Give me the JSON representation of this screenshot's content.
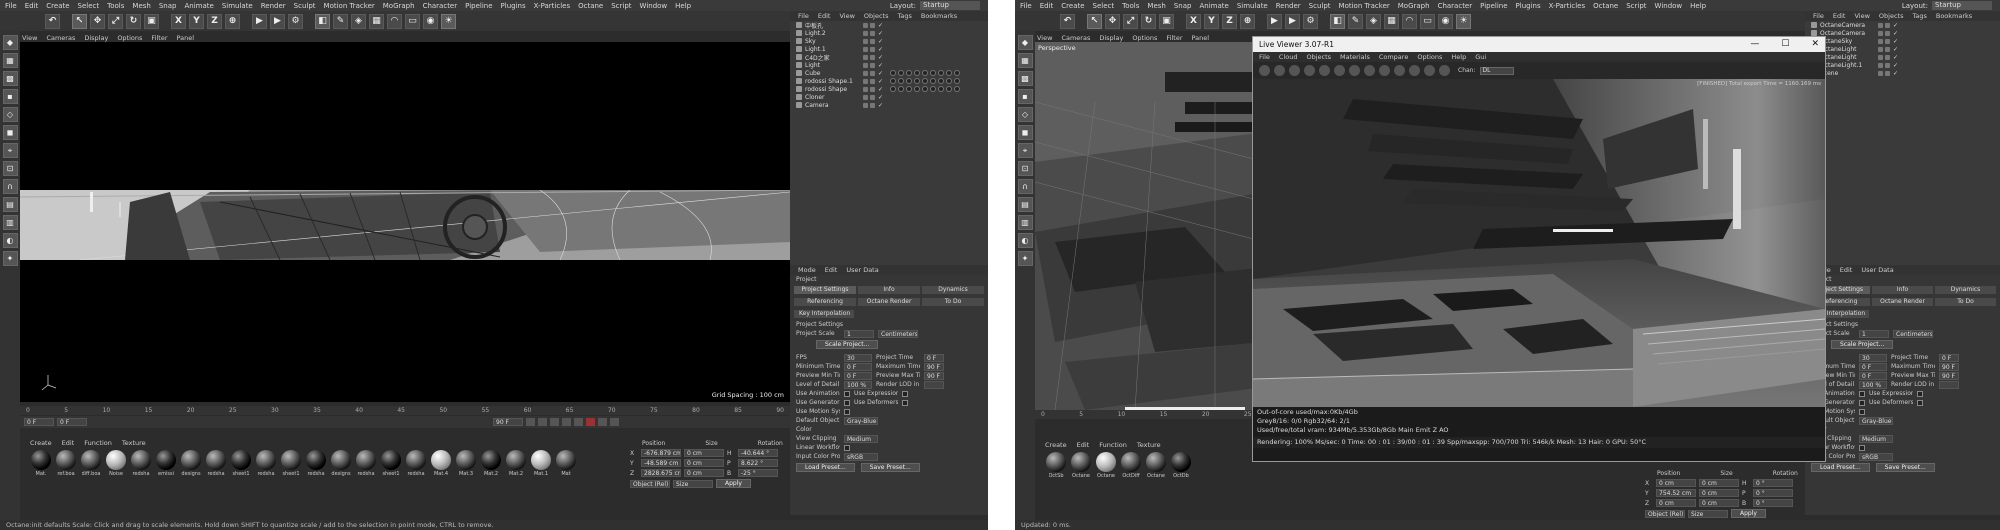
{
  "menu": [
    "File",
    "Edit",
    "Create",
    "Select",
    "Tools",
    "Mesh",
    "Snap",
    "Animate",
    "Simulate",
    "Render",
    "Sculpt",
    "Motion Tracker",
    "MoGraph",
    "Character",
    "Pipeline",
    "Plugins",
    "X-Particles",
    "Octane",
    "Script",
    "Window",
    "Help"
  ],
  "layout": {
    "label": "Layout:",
    "value": "Startup"
  },
  "toolbar_axes": [
    "X",
    "Y",
    "Z"
  ],
  "viewport_menu": [
    "View",
    "Cameras",
    "Display",
    "Options",
    "Filter",
    "Panel"
  ],
  "viewport_label": "Perspective",
  "grid_spacing": "Grid Spacing : 100 cm",
  "timeline_ticks": [
    "0",
    "5",
    "10",
    "15",
    "20",
    "25",
    "30",
    "35",
    "40",
    "45",
    "50",
    "55",
    "60",
    "65",
    "70",
    "75",
    "80",
    "85",
    "90"
  ],
  "frames": {
    "start": "0 F",
    "end": "90 F",
    "current": "0 F"
  },
  "material_menu": [
    "Create",
    "Edit",
    "Function",
    "Texture"
  ],
  "materials": [
    {
      "name": "Mat.",
      "tone": "d"
    },
    {
      "name": "ref.boa",
      "tone": ""
    },
    {
      "name": "diff.boa",
      "tone": ""
    },
    {
      "name": "Noise",
      "tone": "w"
    },
    {
      "name": "redsha",
      "tone": ""
    },
    {
      "name": "emissi",
      "tone": "d"
    },
    {
      "name": "designs",
      "tone": ""
    },
    {
      "name": "redsha",
      "tone": ""
    },
    {
      "name": "sheet1",
      "tone": "d"
    },
    {
      "name": "redsha",
      "tone": ""
    },
    {
      "name": "sheet1",
      "tone": ""
    },
    {
      "name": "redsha",
      "tone": "d"
    },
    {
      "name": "designs",
      "tone": ""
    },
    {
      "name": "redsha",
      "tone": ""
    },
    {
      "name": "sheet1",
      "tone": "d"
    },
    {
      "name": "redsha",
      "tone": ""
    },
    {
      "name": "Mat.4",
      "tone": "w"
    },
    {
      "name": "Mat.3",
      "tone": ""
    },
    {
      "name": "Mat.2",
      "tone": "d"
    },
    {
      "name": "Mat.2",
      "tone": ""
    },
    {
      "name": "Mat.1",
      "tone": "w"
    },
    {
      "name": "Mat",
      "tone": ""
    }
  ],
  "material_menu_right": [
    "Create",
    "Edit",
    "Function",
    "Texture"
  ],
  "materials_right": [
    {
      "name": "OctSb",
      "tone": ""
    },
    {
      "name": "Octane",
      "tone": ""
    },
    {
      "name": "Octane",
      "tone": "w"
    },
    {
      "name": "OctDiff",
      "tone": ""
    },
    {
      "name": "Octane",
      "tone": ""
    },
    {
      "name": "OctDb",
      "tone": "d"
    }
  ],
  "coords": {
    "headers": [
      "Position",
      "Size",
      "Rotation"
    ],
    "rows": [
      {
        "axis": "X",
        "pos": "-676.879 cm",
        "size": "0 cm",
        "rot": "H",
        "rotval": "-40.644 °"
      },
      {
        "axis": "Y",
        "pos": "-48.589 cm",
        "size": "0 cm",
        "rot": "P",
        "rotval": "8.622 °"
      },
      {
        "axis": "Z",
        "pos": "2828.675 cm",
        "size": "0 cm",
        "rot": "B",
        "rotval": "-25 °"
      }
    ],
    "mode1": "Object (Rel)",
    "mode2": "Size",
    "apply": "Apply"
  },
  "coords_right": {
    "rows": [
      {
        "axis": "X",
        "pos": "0 cm",
        "size": "0 cm",
        "rot": "H",
        "rotval": "0 °"
      },
      {
        "axis": "Y",
        "pos": "754.52 cm",
        "size": "0 cm",
        "rot": "P",
        "rotval": "0 °"
      },
      {
        "axis": "Z",
        "pos": "0 cm",
        "size": "0 cm",
        "rot": "B",
        "rotval": "0 °"
      }
    ],
    "mode1": "Object (Rel)",
    "mode2": "Size",
    "apply": "Apply"
  },
  "object_menu": [
    "File",
    "Edit",
    "View",
    "Objects",
    "Tags",
    "Bookmarks"
  ],
  "objects_left": [
    "Light.2",
    "Sky",
    "Light.1",
    "C4D之家",
    "Light",
    "Cube",
    "rodossi Shape.1",
    "rodossi Shape",
    "Cloner",
    "Camera"
  ],
  "objects_left_top": "中板孔",
  "objects_right": [
    "OctaneCamera",
    "OctaneCamera",
    "OctaneSky",
    "OctaneLight",
    "OctaneLight",
    "OctaneLight.1",
    "Scene"
  ],
  "attr_menu": [
    "Mode",
    "Edit",
    "User Data"
  ],
  "attr_title": "Project",
  "attr_tabs_1": [
    "Project Settings",
    "Info",
    "Dynamics"
  ],
  "attr_tabs_2": [
    "Referencing",
    "Octane Render",
    "To Do"
  ],
  "attr_tab_3": "Key Interpolation",
  "attr_section": "Project Settings",
  "project_scale": {
    "label": "Project Scale",
    "value": "1",
    "unit": "Centimeters"
  },
  "scale_btn": "Scale Project...",
  "attr_rows": [
    {
      "l1": "FPS",
      "v1": "30",
      "l2": "Project Time",
      "v2": "0 F"
    },
    {
      "l1": "Minimum Time",
      "v1": "0 F",
      "l2": "Maximum Time",
      "v2": "90 F"
    },
    {
      "l1": "Preview Min Time",
      "v1": "0 F",
      "l2": "Preview Max Time",
      "v2": "90 F"
    },
    {
      "l1": "Level of Detail",
      "v1": "100 %",
      "l2": "Render LOD in Editor",
      "v2": ""
    }
  ],
  "attr_checks": [
    {
      "l1": "Use Animation",
      "l2": "Use Expression"
    },
    {
      "l1": "Use Generators",
      "l2": "Use Deformers"
    },
    {
      "l1": "Use Motion System",
      "l2": ""
    }
  ],
  "obj_color": {
    "label": "Default Object Color",
    "value": "Gray-Blue"
  },
  "color_label": "Color",
  "view_clip": {
    "label": "View Clipping",
    "value": "Medium"
  },
  "linear": "Linear Workflow",
  "input_profile": {
    "label": "Input Color Profile",
    "value": "sRGB"
  },
  "load_btn": "Load Preset...",
  "save_btn": "Save Preset...",
  "status_left": "Octane:init defaults     Scale: Click and drag to scale elements. Hold down SHIFT to quantize scale / add to the selection in point mode, CTRL to remove.",
  "status_right": "Updated: 0 ms.",
  "live_viewer": {
    "title": "Live Viewer 3.07-R1",
    "win_controls": [
      "—",
      "☐",
      "✕"
    ],
    "menu": [
      "File",
      "Cloud",
      "Objects",
      "Materials",
      "Compare",
      "Options",
      "Help",
      "Gui"
    ],
    "channel_label": "Chan:",
    "channel_value": "DL",
    "finished": "[FINISHED] Total export Time = 1160.169 ms",
    "stats": [
      "Out-of-core used/max:0Kb/4Gb",
      "Grey8/16: 0/0          Rgb32/64: 2/1",
      "Used/free/total vram: 934Mb/5.353Gb/8Gb     Main  Emit    Z    AO",
      "Rendering: 100%  Ms/sec: 0   Time: 00 : 01 : 39/00 : 01 : 39   Spp/maxspp: 700/700    Tri: 546k/k   Mesh: 13    Hair: 0    GPU:   50°C"
    ]
  }
}
